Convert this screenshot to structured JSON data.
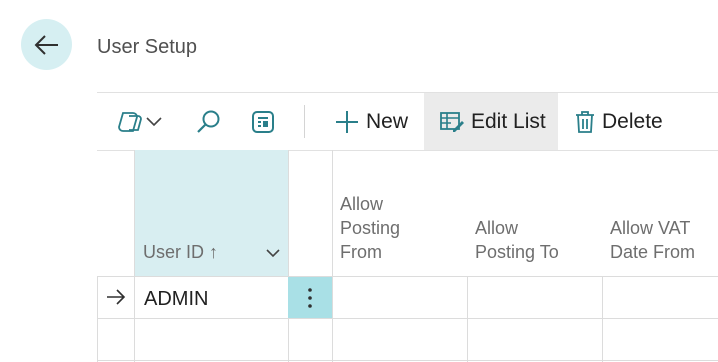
{
  "page": {
    "title": "User Setup"
  },
  "toolbar": {
    "new_label": "New",
    "edit_list_label": "Edit List",
    "delete_label": "Delete"
  },
  "table": {
    "columns": [
      {
        "label": "User ID ↑"
      },
      {
        "label_lines": [
          "Allow",
          "Posting",
          "From"
        ]
      },
      {
        "label_lines": [
          "Allow",
          "Posting To"
        ]
      },
      {
        "label_lines": [
          "Allow VAT",
          "Date From"
        ]
      }
    ],
    "rows": [
      {
        "user_id": "ADMIN"
      }
    ]
  },
  "colors": {
    "accent_light": "#d8eef1",
    "accent_selected": "#a9e0e6"
  },
  "icons": [
    "back-arrow-icon",
    "copilot-icon",
    "chevron-down-icon",
    "search-icon",
    "filter-pane-icon",
    "plus-icon",
    "edit-list-icon",
    "trash-icon",
    "row-arrow-icon",
    "more-options-icon"
  ]
}
